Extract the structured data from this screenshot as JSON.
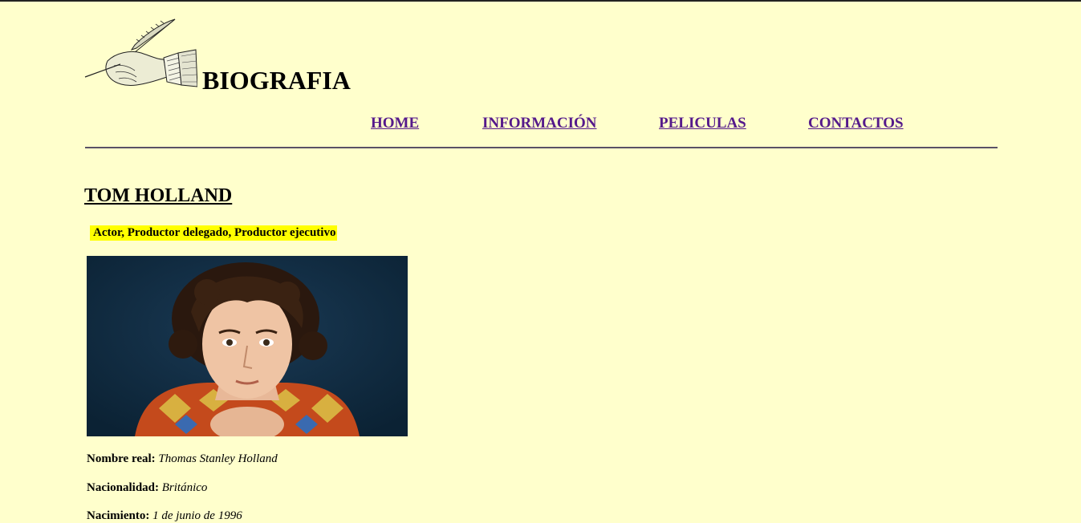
{
  "header": {
    "title": "BIOGRAFIA",
    "logo_icon": "quill-hand-icon"
  },
  "nav": {
    "home": "HOME",
    "info": "INFORMACIÓN",
    "movies": "PELICULAS",
    "contact": "CONTACTOS"
  },
  "person": {
    "name": "TOM HOLLAND",
    "roles": "Actor, Productor delegado, Productor ejecutivo",
    "photo_icon": "portrait-photo"
  },
  "details": [
    {
      "label": "Nombre real:",
      "value": "Thomas Stanley Holland"
    },
    {
      "label": "Nacionalidad:",
      "value": "Británico"
    },
    {
      "label": "Nacimiento:",
      "value": "1 de junio de 1996"
    }
  ],
  "colors": {
    "background": "#ffffcc",
    "link": "#551a8b",
    "highlight": "#ffff00",
    "divider": "#5a5266"
  }
}
